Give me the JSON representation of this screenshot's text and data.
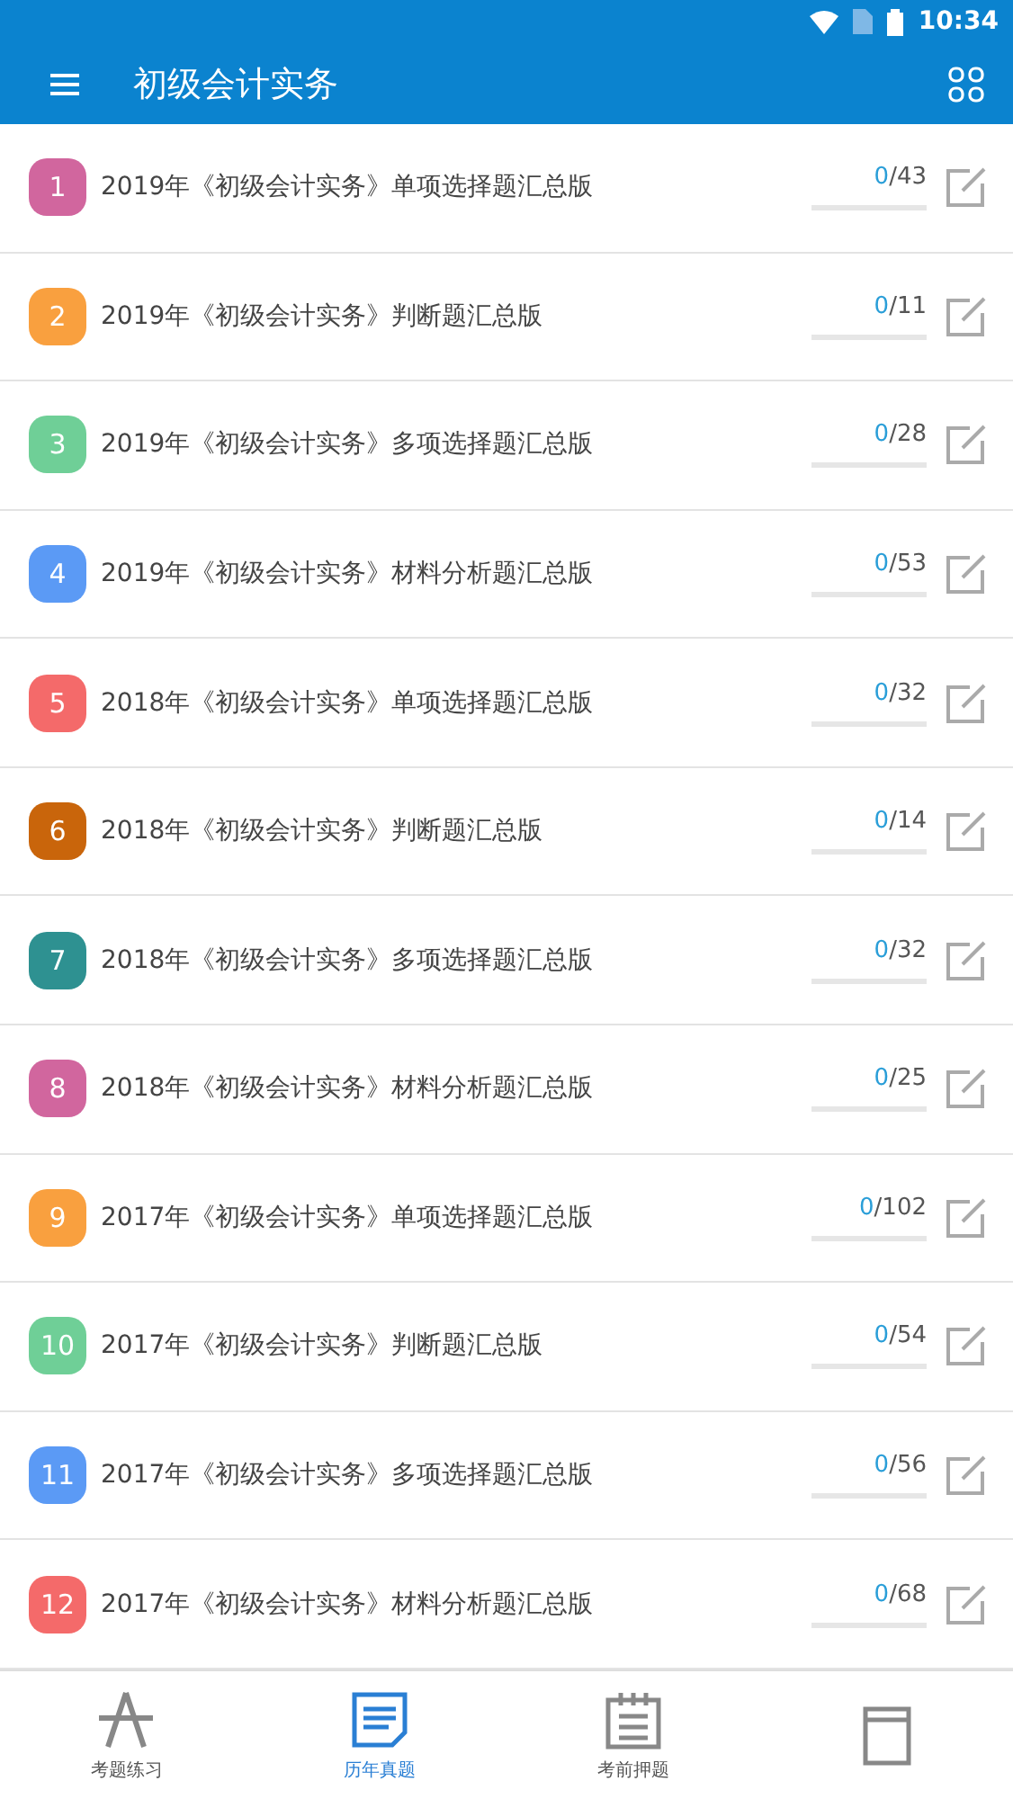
{
  "status_bar": {
    "time": "10:34"
  },
  "toolbar": {
    "title": "初级会计实务"
  },
  "items": [
    {
      "number": "1",
      "color": "#d1669e",
      "title": "2019年《初级会计实务》单项选择题汇总版",
      "done": "0",
      "total": "/43",
      "level": 0
    },
    {
      "number": "2",
      "color": "#f9a03f",
      "title": "2019年《初级会计实务》判断题汇总版",
      "done": "0",
      "total": "/11",
      "level": 0
    },
    {
      "number": "3",
      "color": "#6fcf97",
      "title": "2019年《初级会计实务》多项选择题汇总版",
      "done": "0",
      "total": "/28",
      "level": 0
    },
    {
      "number": "4",
      "color": "#5b9af5",
      "title": "2019年《初级会计实务》材料分析题汇总版",
      "done": "0",
      "total": "/53",
      "level": 0
    },
    {
      "number": "5",
      "color": "#f46a6a",
      "title": "2018年《初级会计实务》单项选择题汇总版",
      "done": "0",
      "total": "/32",
      "level": 0
    },
    {
      "number": "6",
      "color": "#c9650b",
      "title": "2018年《初级会计实务》判断题汇总版",
      "done": "0",
      "total": "/14",
      "level": 0
    },
    {
      "number": "7",
      "color": "#2e9191",
      "title": "2018年《初级会计实务》多项选择题汇总版",
      "done": "0",
      "total": "/32",
      "level": 0
    },
    {
      "number": "8",
      "color": "#d1669e",
      "title": "2018年《初级会计实务》材料分析题汇总版",
      "done": "0",
      "total": "/25",
      "level": 0
    },
    {
      "number": "9",
      "color": "#f9a03f",
      "title": "2017年《初级会计实务》单项选择题汇总版",
      "done": "0",
      "total": "/102",
      "level": 0
    },
    {
      "number": "10",
      "color": "#6fcf97",
      "title": "2017年《初级会计实务》判断题汇总版",
      "done": "0",
      "total": "/54",
      "level": 0
    },
    {
      "number": "11",
      "color": "#5b9af5",
      "title": "2017年《初级会计实务》多项选择题汇总版",
      "done": "0",
      "total": "/56",
      "level": 0
    },
    {
      "number": "12",
      "color": "#f46a6a",
      "title": "2017年《初级会计实务》材料分析题汇总版",
      "done": "0",
      "total": "/68",
      "level": 0
    }
  ],
  "bottom_nav": [
    {
      "kind": "pencil",
      "label": "考题练习",
      "selected": false
    },
    {
      "kind": "paper",
      "label": "历年真题",
      "selected": true
    },
    {
      "kind": "calendar",
      "label": "考前押题",
      "selected": false
    },
    {
      "kind": "book",
      "selected": false
    }
  ]
}
